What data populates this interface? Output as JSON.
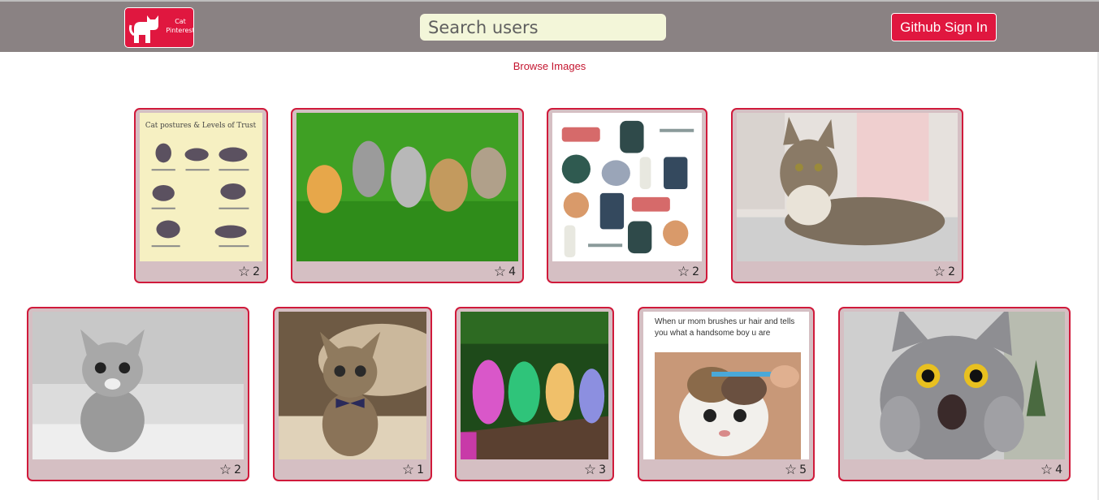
{
  "navbar": {
    "logo_text": "Cat Pinterest",
    "search_placeholder": "Search users",
    "signin_label": "Github Sign In"
  },
  "browse_label": "Browse Images",
  "images": [
    {
      "icon": "cat-trust-poster",
      "favs": "2"
    },
    {
      "icon": "kittens-on-grass",
      "favs": "4"
    },
    {
      "icon": "meow-stickers",
      "favs": "2"
    },
    {
      "icon": "tabby-on-sofa",
      "favs": "2"
    },
    {
      "icon": "silver-kitten",
      "favs": "2"
    },
    {
      "icon": "bowtie-kitten",
      "favs": "1"
    },
    {
      "icon": "colorful-kittens",
      "favs": "3"
    },
    {
      "icon": "meme-brushing-cat",
      "favs": "5"
    },
    {
      "icon": "shocked-grey-cat",
      "favs": "4"
    }
  ],
  "meme_text": "When ur mom brushes ur hair and tells you what a handsome boy u are",
  "poster_title": "Cat postures & Levels of Trust",
  "colors": {
    "navbar": "#8a8283",
    "accent": "#e0173f",
    "card_bg": "#d5bfc3",
    "card_border": "#d01a3b",
    "link": "#c4152f"
  }
}
